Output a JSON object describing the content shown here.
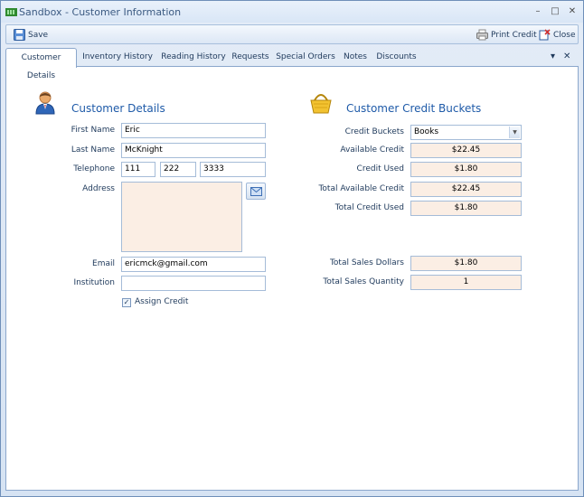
{
  "window": {
    "title": "Sandbox - Customer Information",
    "minimize": "–",
    "maximize": "□",
    "close": "✕"
  },
  "toolbar": {
    "save_label": "Save",
    "print_label": "Print Credit",
    "close_label": "Close"
  },
  "tabs": [
    {
      "label": "Customer Details",
      "active": true
    },
    {
      "label": "Inventory  History"
    },
    {
      "label": "Reading History"
    },
    {
      "label": "Requests"
    },
    {
      "label": "Special Orders"
    },
    {
      "label": "Notes"
    },
    {
      "label": "Discounts"
    }
  ],
  "tab_controls": {
    "menu": "▾",
    "close": "✕"
  },
  "customer": {
    "section_title": "Customer Details",
    "first_name_label": "First Name",
    "first_name": "Eric",
    "last_name_label": "Last Name",
    "last_name": "McKnight",
    "telephone_label": "Telephone",
    "phone_area": "111",
    "phone_prefix": "222",
    "phone_line": "3333",
    "address_label": "Address",
    "address": "",
    "email_label": "Email",
    "email": "ericmck@gmail.com",
    "institution_label": "Institution",
    "institution": "",
    "assign_credit_label": "Assign Credit",
    "assign_credit_checked": true
  },
  "credit": {
    "section_title": "Customer Credit Buckets",
    "buckets_label": "Credit Buckets",
    "buckets_value": "Books",
    "available_label": "Available Credit",
    "available": "$22.45",
    "used_label": "Credit Used",
    "used": "$1.80",
    "total_available_label": "Total Available Credit",
    "total_available": "$22.45",
    "total_used_label": "Total Credit Used",
    "total_used": "$1.80",
    "sales_dollars_label": "Total Sales Dollars",
    "sales_dollars": "$1.80",
    "sales_qty_label": "Total Sales Quantity",
    "sales_qty": "1"
  }
}
